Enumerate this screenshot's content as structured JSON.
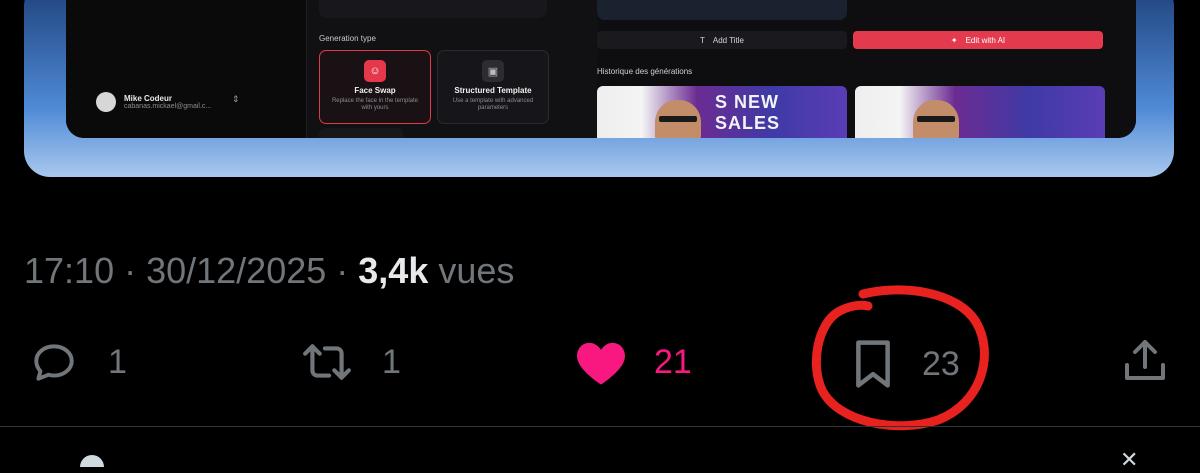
{
  "embedded_app": {
    "user": {
      "name": "Mike Codeur",
      "email": "cabanas.mickael@gmail.c..."
    },
    "generation_type_label": "Generation type",
    "options": [
      {
        "title": "Face Swap",
        "desc": "Replace the face in the template with yours"
      },
      {
        "title": "Structured Template",
        "desc": "Use a template with advanced parameters"
      }
    ],
    "add_title_label": "Add Title",
    "edit_ai_label": "Edit with AI",
    "history_label": "Historique des générations",
    "thumb_text": "S NEW SALES"
  },
  "tweet": {
    "time": "17:10",
    "sep1": " · ",
    "date": "30/12/2025",
    "sep2": " · ",
    "views_count": "3,4k",
    "views_label": " vues"
  },
  "actions": {
    "replies": "1",
    "retweets": "1",
    "likes": "21",
    "bookmarks": "23"
  },
  "colors": {
    "like": "#f91880",
    "muted": "#71767b",
    "circle": "#e8221e",
    "accent": "#e33a4d"
  },
  "icons": [
    "reply-icon",
    "retweet-icon",
    "heart-icon",
    "bookmark-icon",
    "share-icon"
  ]
}
